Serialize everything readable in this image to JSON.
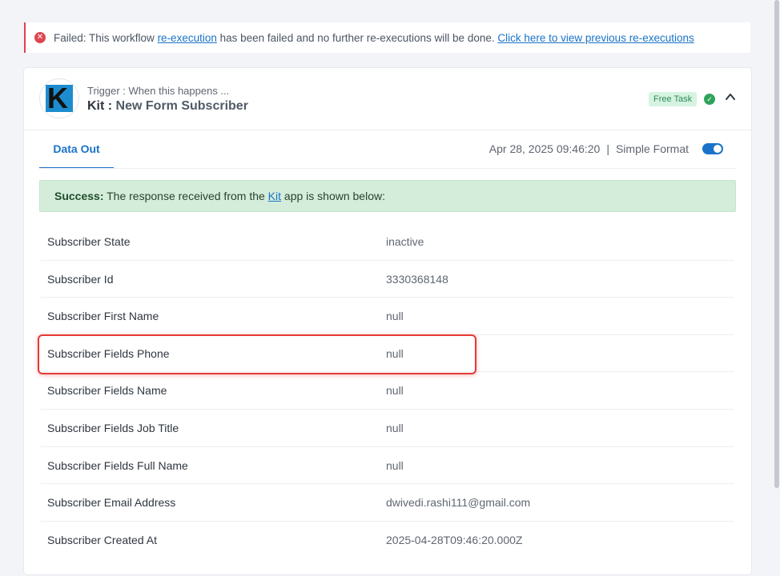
{
  "alert": {
    "icon": "error-icon",
    "prefix": "Failed: This workflow ",
    "link1": "re-execution",
    "middle": " has been failed and no further re-executions will be done. ",
    "link2": "Click here to view previous re-executions",
    "color": "#e0454f"
  },
  "step": {
    "logo_letter": "K",
    "trigger_label": "Trigger : When this happens ...",
    "app_name": "Kit",
    "separator": " : ",
    "event_name": "New Form Subscriber",
    "badge": "Free Task",
    "status_icon": "check-circle-icon",
    "collapse_icon": "chevron-up-icon"
  },
  "tabs": {
    "active": "Data Out"
  },
  "meta": {
    "timestamp": "Apr 28, 2025 09:46:20",
    "separator": "|",
    "format_label": "Simple Format",
    "format_enabled": true
  },
  "success": {
    "label": "Success:",
    "text_before": " The response received from the ",
    "link": "Kit",
    "text_after": " app is shown below:"
  },
  "rows": [
    {
      "key": "Subscriber State",
      "value": "inactive"
    },
    {
      "key": "Subscriber Id",
      "value": "3330368148"
    },
    {
      "key": "Subscriber First Name",
      "value": "null"
    },
    {
      "key": "Subscriber Fields Phone",
      "value": "null"
    },
    {
      "key": "Subscriber Fields Name",
      "value": "null"
    },
    {
      "key": "Subscriber Fields Job Title",
      "value": "null"
    },
    {
      "key": "Subscriber Fields Full Name",
      "value": "null"
    },
    {
      "key": "Subscriber Email Address",
      "value": "dwivedi.rashi111@gmail.com"
    },
    {
      "key": "Subscriber Created At",
      "value": "2025-04-28T09:46:20.000Z"
    }
  ],
  "colors": {
    "accent": "#1a73c8",
    "highlight": "#e53935",
    "success_bg": "#d4edda"
  }
}
